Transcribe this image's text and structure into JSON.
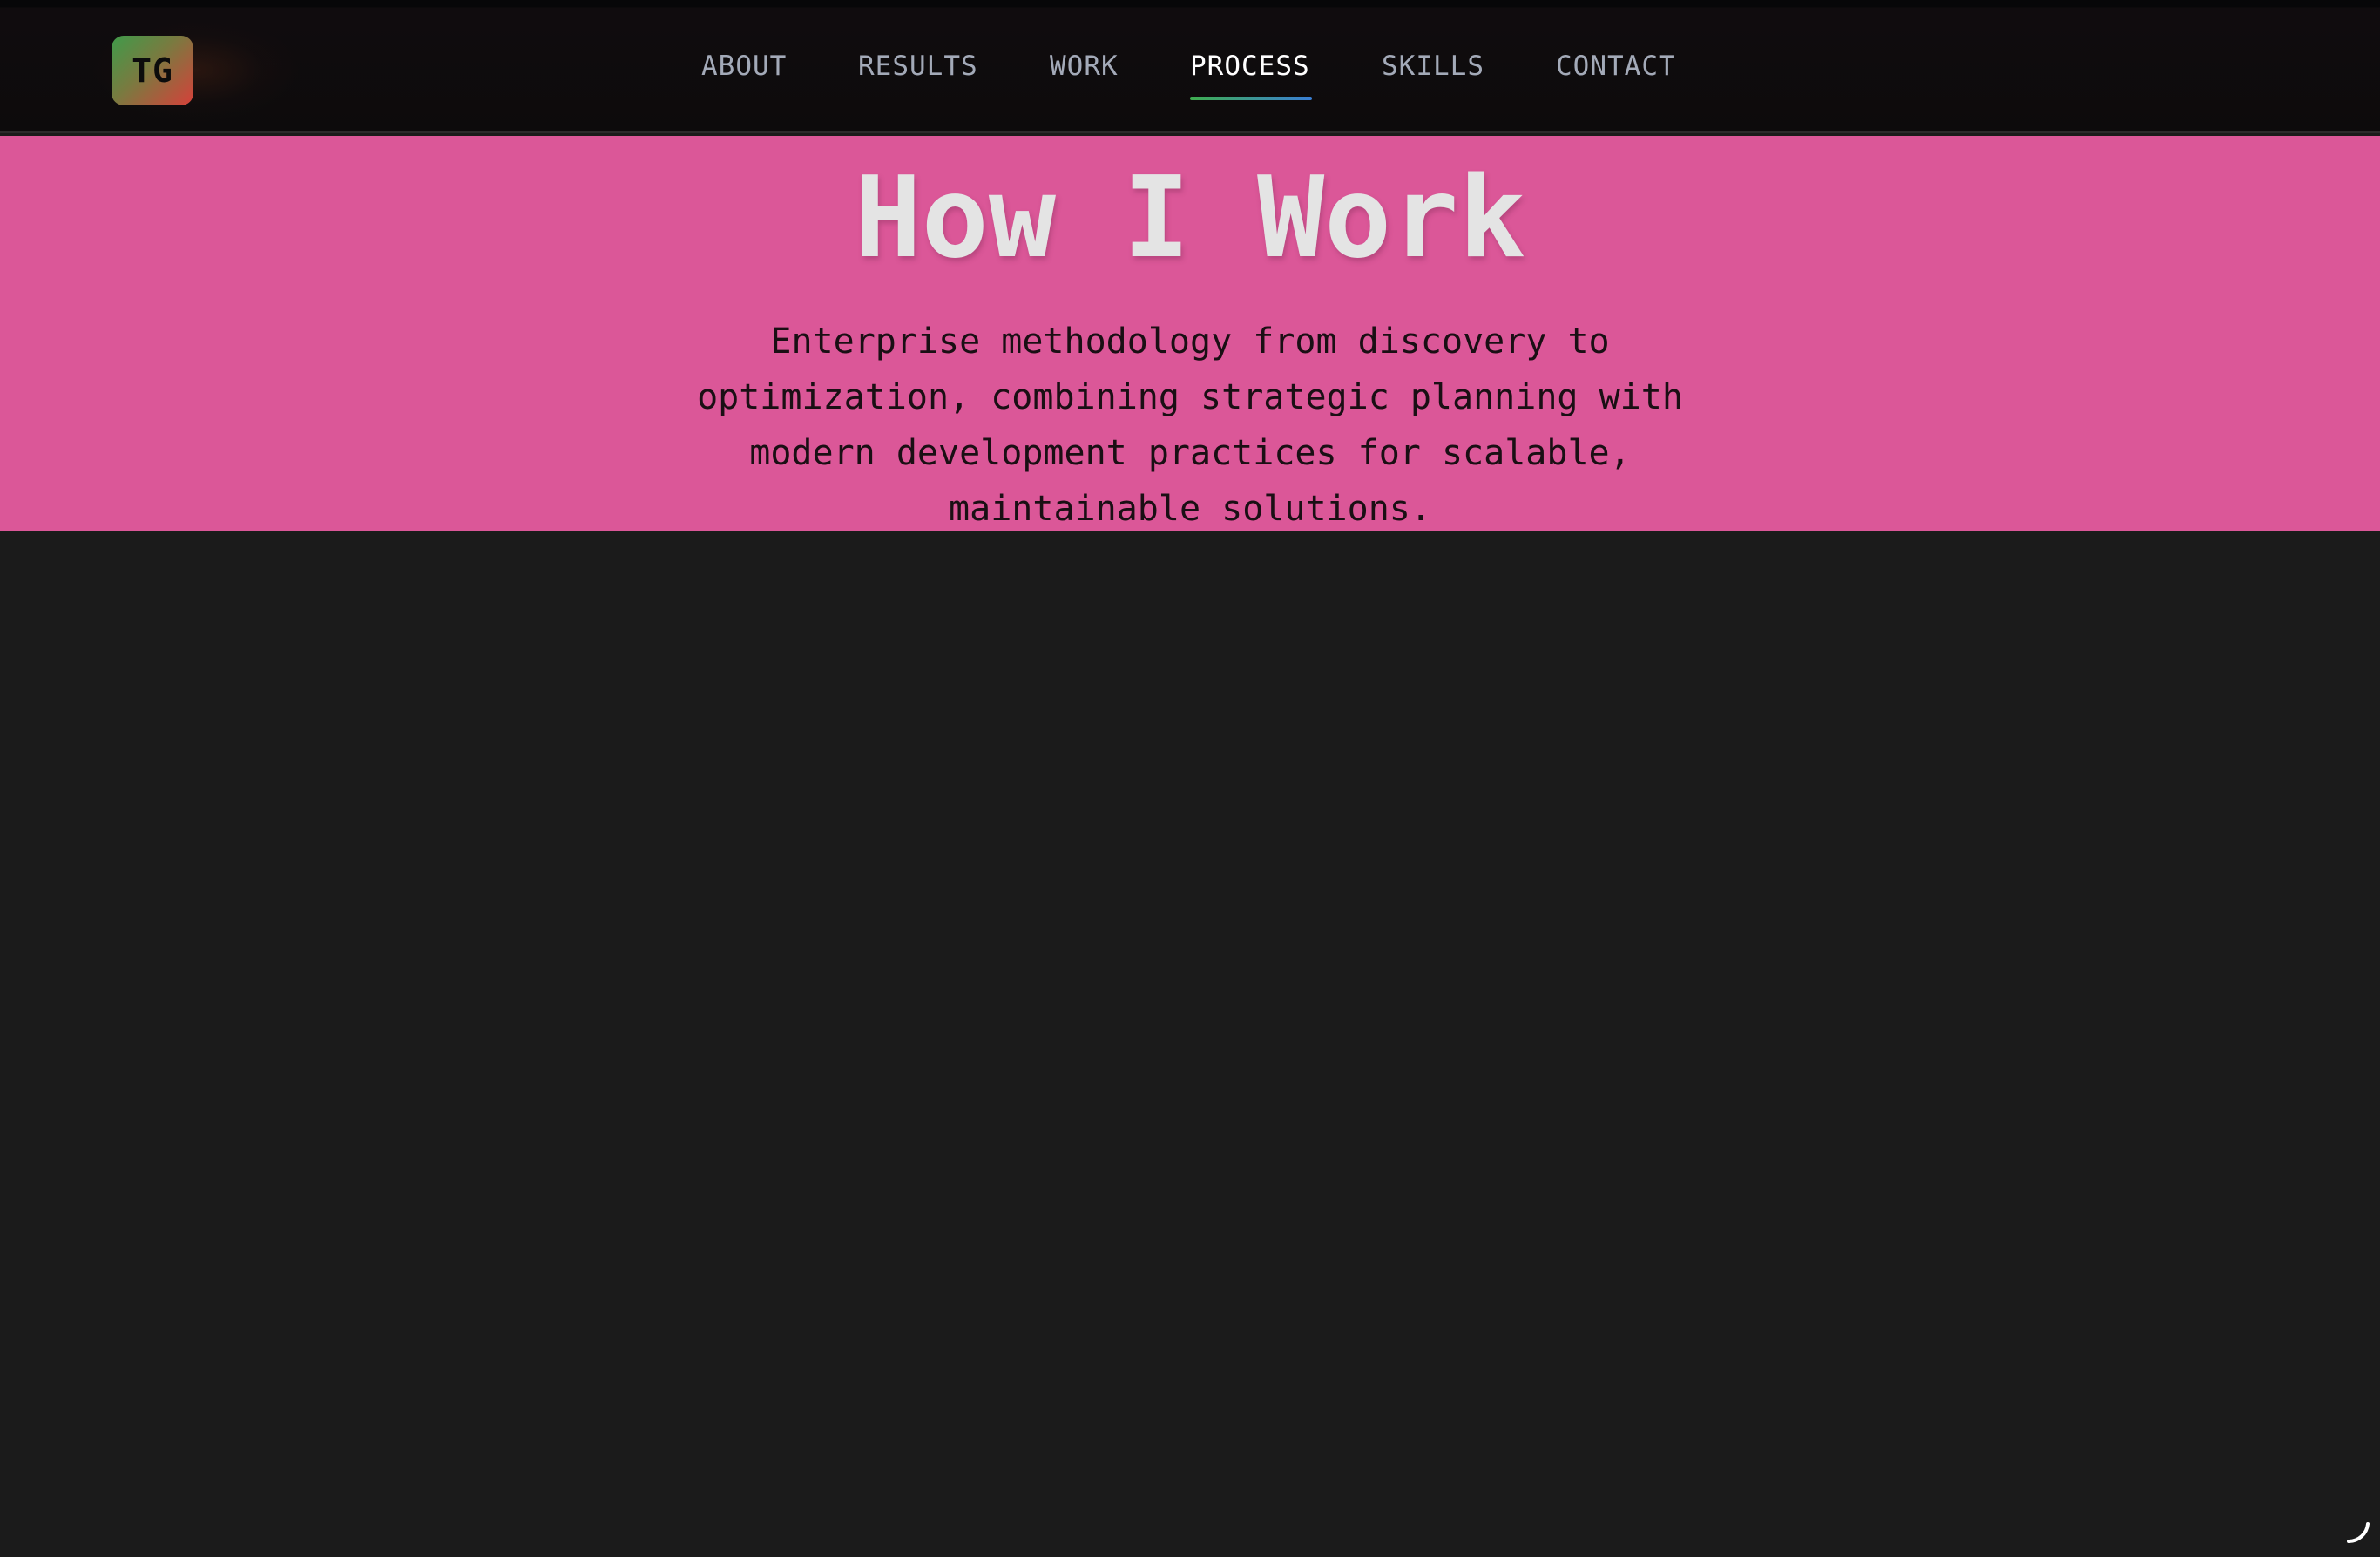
{
  "header": {
    "logo_text": "TG",
    "nav": [
      {
        "label": "ABOUT",
        "active": false
      },
      {
        "label": "RESULTS",
        "active": false
      },
      {
        "label": "WORK",
        "active": false
      },
      {
        "label": "PROCESS",
        "active": true
      },
      {
        "label": "SKILLS",
        "active": false
      },
      {
        "label": "CONTACT",
        "active": false
      }
    ]
  },
  "hero": {
    "title": "How I Work",
    "subtitle": "Enterprise methodology from discovery to optimization, combining strategic planning with modern development practices for scalable, maintainable solutions."
  },
  "colors": {
    "hero_background": "#db5798",
    "page_background": "#1b1b1b",
    "nav_background": "#0d0b0c",
    "nav_text": "#a3aab8",
    "nav_active_text": "#ffffff",
    "underline_start": "#3fae4f",
    "underline_end": "#3a7fd6"
  },
  "icons": {
    "loading": "loading-spinner-icon"
  }
}
